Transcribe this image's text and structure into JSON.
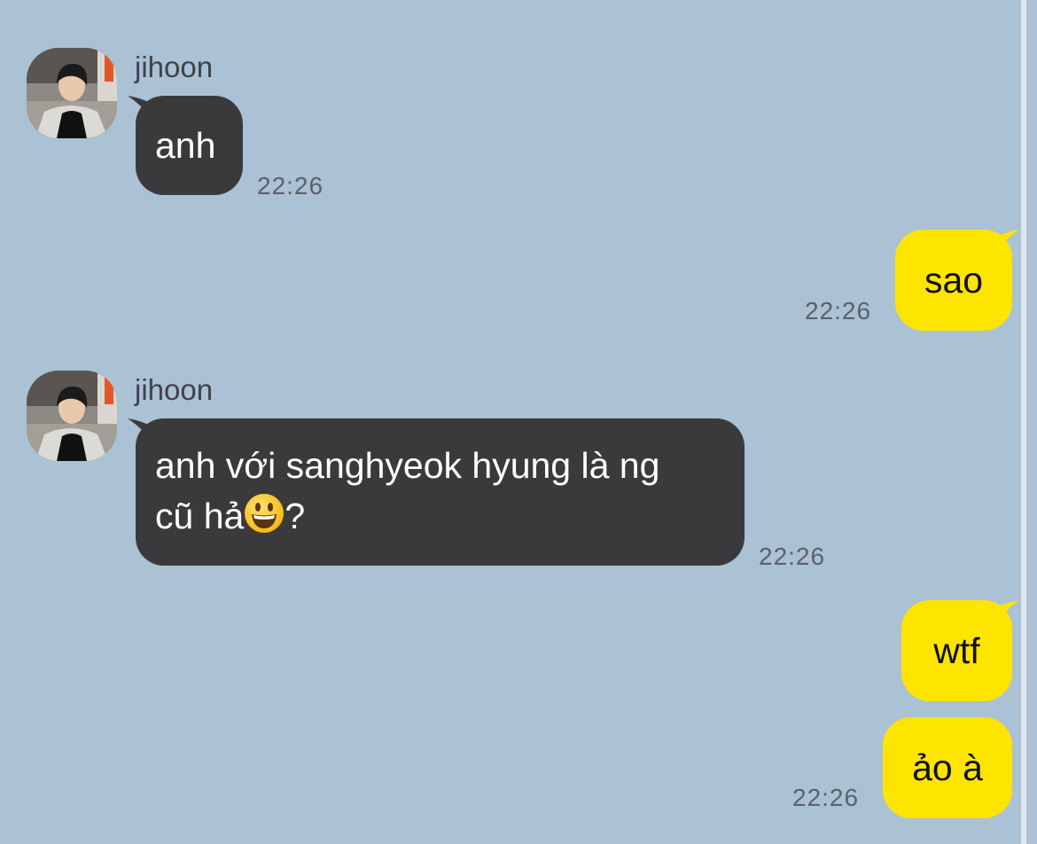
{
  "chat": {
    "messages": [
      {
        "sender": "jihoon",
        "direction": "incoming",
        "text": "anh",
        "time": "22:26"
      },
      {
        "direction": "outgoing",
        "text": "sao",
        "time": "22:26"
      },
      {
        "sender": "jihoon",
        "direction": "incoming",
        "text_line1": "anh với sanghyeok hyung là ng",
        "text_line2": "cũ hả",
        "text_emoji": "grinning-face-emoji",
        "text_end": "?",
        "time": "22:26"
      },
      {
        "direction": "outgoing",
        "text": "wtf"
      },
      {
        "direction": "outgoing",
        "text": "ảo à",
        "time": "22:26"
      }
    ]
  },
  "colors": {
    "background": "#abc1d4",
    "incoming_bubble": "#3a3a3c",
    "outgoing_bubble": "#fee500"
  }
}
